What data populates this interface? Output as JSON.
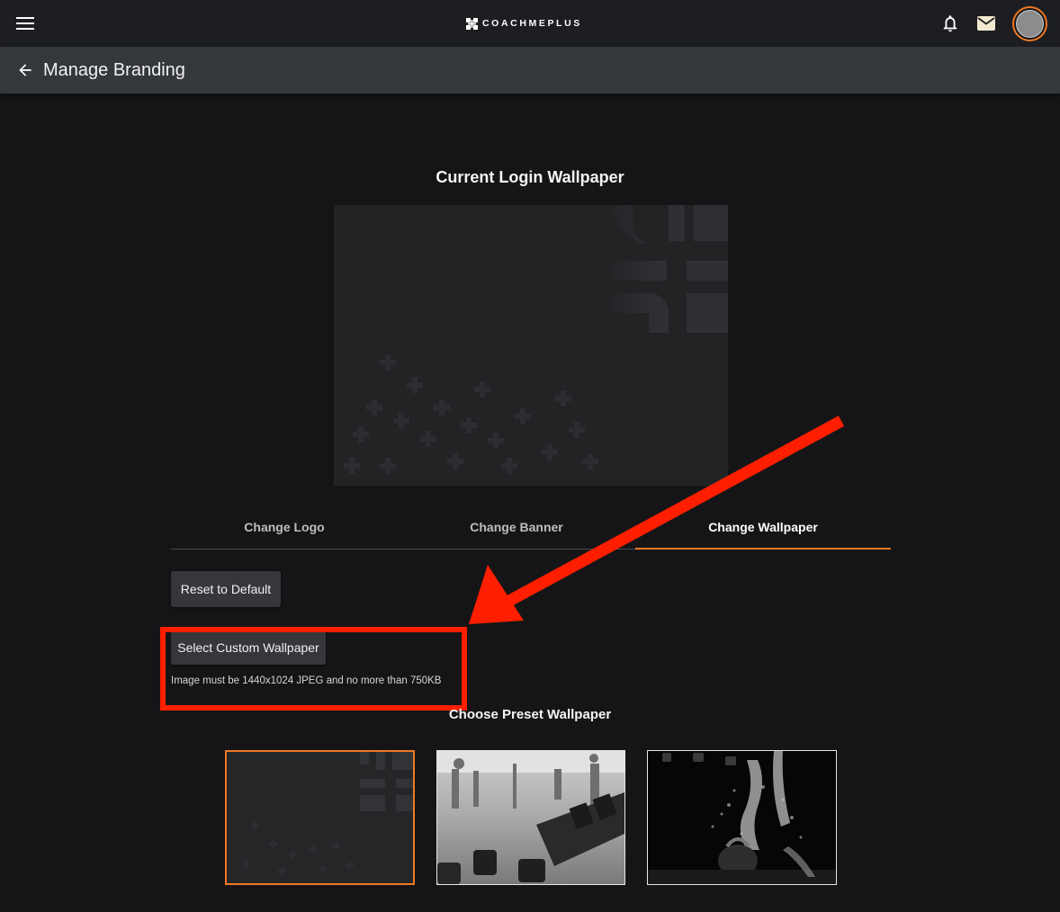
{
  "header": {
    "brand_name": "COACHMEPLUS",
    "icons": {
      "menu": "hamburger-icon",
      "notifications": "bell-icon",
      "messages": "envelope-icon",
      "profile": "avatar"
    },
    "accent_color": "#f07822"
  },
  "subheader": {
    "back_icon": "arrow-left-icon",
    "title": "Manage Branding"
  },
  "current_wallpaper": {
    "title": "Current Login Wallpaper"
  },
  "tabs": [
    {
      "label": "Change Logo",
      "active": false
    },
    {
      "label": "Change Banner",
      "active": false
    },
    {
      "label": "Change Wallpaper",
      "active": true
    }
  ],
  "actions": {
    "reset_label": "Reset to Default",
    "select_custom_label": "Select Custom Wallpaper",
    "requirement_hint": "Image must be 1440x1024 JPEG and no more than 750KB"
  },
  "presets": {
    "title": "Choose Preset Wallpaper",
    "items": [
      {
        "name": "default-dark-pattern",
        "selected": true
      },
      {
        "name": "gym-dumbbells-grayscale",
        "selected": false
      },
      {
        "name": "kettlebell-chalk-dark",
        "selected": false
      }
    ]
  },
  "annotation": {
    "color": "#ff1f00"
  }
}
